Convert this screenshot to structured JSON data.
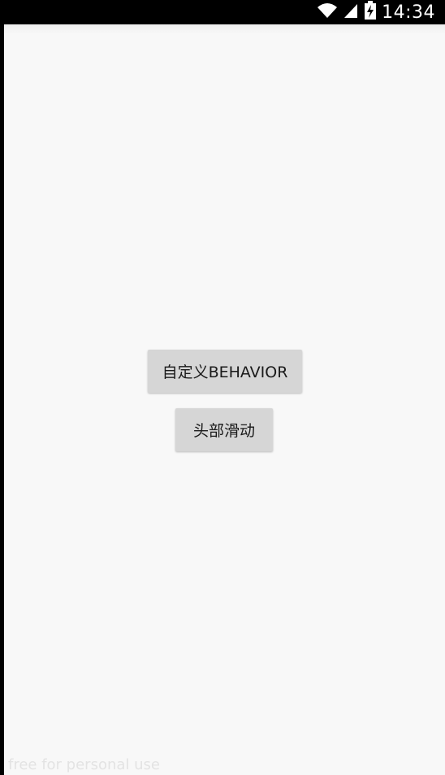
{
  "status_bar": {
    "time": "14:34",
    "icons": [
      "wifi-icon",
      "signal-icon",
      "battery-charging-icon"
    ]
  },
  "main": {
    "buttons": [
      {
        "label": "自定义BEHAVIOR"
      },
      {
        "label": "头部滑动"
      }
    ]
  },
  "watermark": "free for personal use"
}
